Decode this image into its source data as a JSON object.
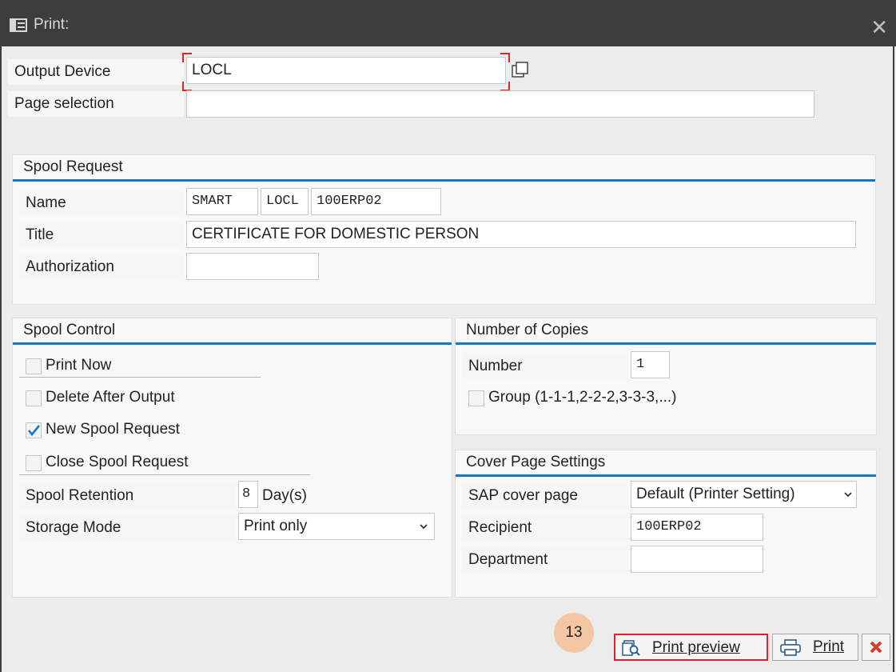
{
  "window": {
    "title": "Print:",
    "close_label": "✕"
  },
  "output_device": {
    "label": "Output Device",
    "value": "LOCL"
  },
  "page_selection": {
    "label": "Page selection",
    "value": ""
  },
  "spool_request": {
    "heading": "Spool Request",
    "name_label": "Name",
    "name_parts": [
      "SMART",
      "LOCL",
      "100ERP02"
    ],
    "title_label": "Title",
    "title_value": "CERTIFICATE FOR DOMESTIC PERSON",
    "authorization_label": "Authorization",
    "authorization_value": ""
  },
  "spool_control": {
    "heading": "Spool Control",
    "print_now": {
      "label": "Print Now",
      "checked": false
    },
    "delete_after_output": {
      "label": "Delete After Output",
      "checked": false
    },
    "new_spool_request": {
      "label": "New Spool Request",
      "checked": true
    },
    "close_spool_request": {
      "label": "Close Spool Request",
      "checked": false
    },
    "retention_label": "Spool Retention",
    "retention_value": "8",
    "retention_unit": "Day(s)",
    "storage_mode_label": "Storage Mode",
    "storage_mode_value": "Print only"
  },
  "number_of_copies": {
    "heading": "Number of Copies",
    "number_label": "Number",
    "number_value": "1",
    "group_label": "Group (1-1-1,2-2-2,3-3-3,...)",
    "group_checked": false
  },
  "cover_page": {
    "heading": "Cover Page Settings",
    "sap_cover_label": "SAP cover page",
    "sap_cover_value": "Default (Printer Setting)",
    "recipient_label": "Recipient",
    "recipient_value": "100ERP02",
    "department_label": "Department",
    "department_value": ""
  },
  "buttons": {
    "print_preview": "Print preview",
    "print": "Print"
  },
  "step_badge": "13",
  "colors": {
    "accent": "#1976c6",
    "titlebar": "#3d3d3d",
    "cancel": "#d0402a",
    "highlight": "#e0222a"
  }
}
